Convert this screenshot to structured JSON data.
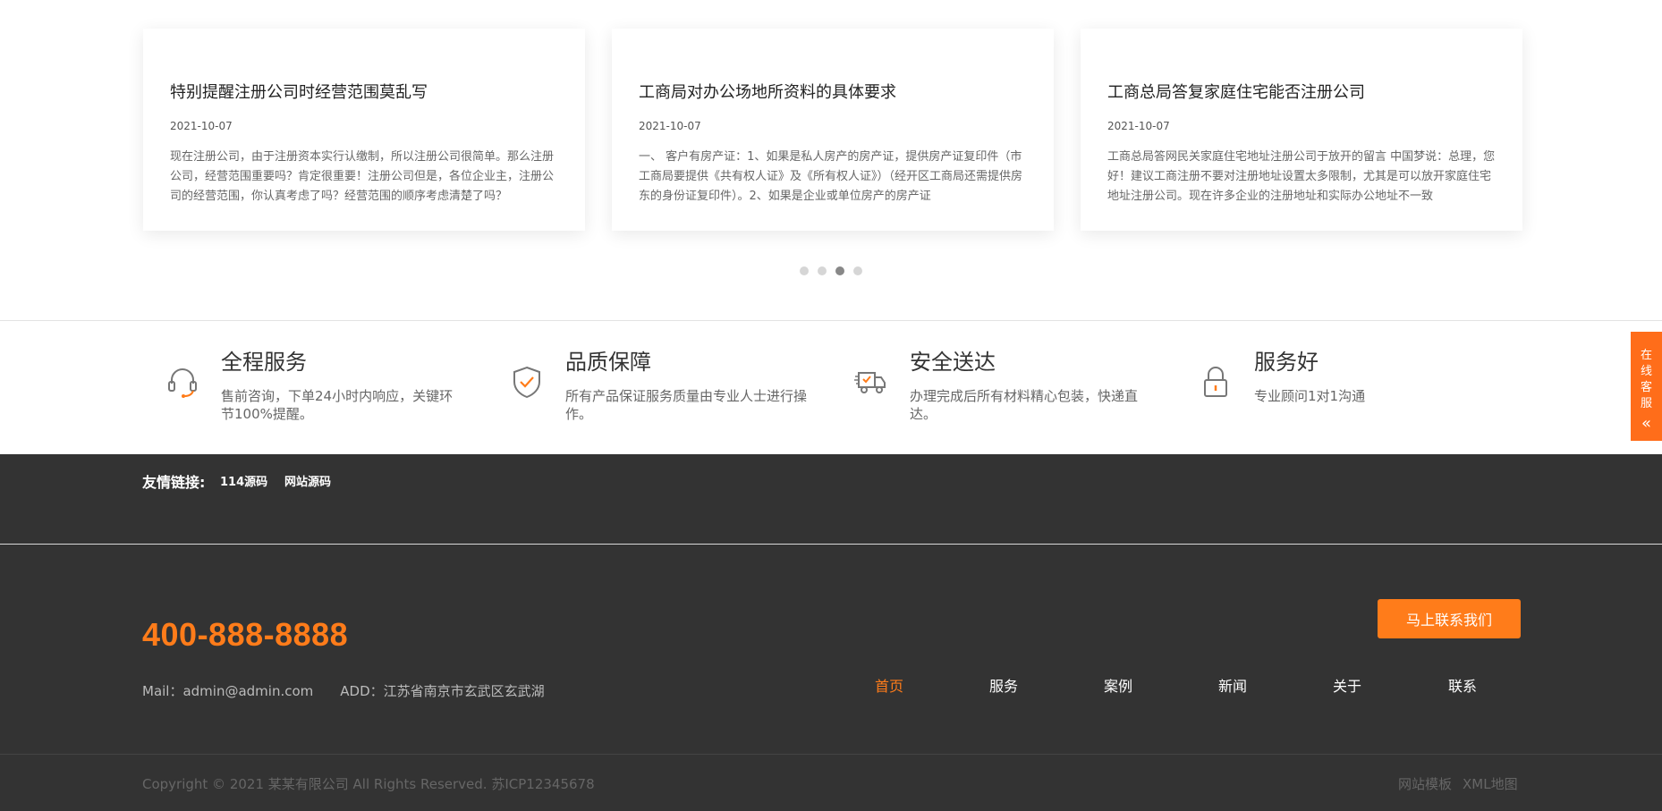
{
  "news": {
    "cards": [
      {
        "title": "特别提醒注册公司时经营范围莫乱写",
        "date": "2021-10-07",
        "excerpt": "现在注册公司，由于注册资本实行认缴制，所以注册公司很简单。那么注册公司，经营范围重要吗？肯定很重要！注册公司但是，各位企业主，注册公司的经营范围，你认真考虑了吗？经营范围的顺序考虑清楚了吗？"
      },
      {
        "title": "工商局对办公场地所资料的具体要求",
        "date": "2021-10-07",
        "excerpt": "一、 客户有房产证：1、如果是私人房产的房产证，提供房产证复印件（市工商局要提供《共有权人证》及《所有权人证》）（经开区工商局还需提供房东的身份证复印件）。2、如果是企业或单位房产的房产证"
      },
      {
        "title": "工商总局答复家庭住宅能否注册公司",
        "date": "2021-10-07",
        "excerpt": "工商总局答网民关家庭住宅地址注册公司于放开的留言 中国梦说：总理，您好！建议工商注册不要对注册地址设置太多限制，尤其是可以放开家庭住宅地址注册公司。现在许多企业的注册地址和实际办公地址不一致"
      }
    ],
    "pagination": {
      "total": 4,
      "active_index": 2
    }
  },
  "features": [
    {
      "icon": "headset-icon",
      "title": "全程服务",
      "desc": "售前咨询，下单24小时内响应，关键环节100%提醒。"
    },
    {
      "icon": "shield-check-icon",
      "title": "品质保障",
      "desc": "所有产品保证服务质量由专业人士进行操作。"
    },
    {
      "icon": "truck-icon",
      "title": "安全送达",
      "desc": "办理完成后所有材料精心包装，快递直达。"
    },
    {
      "icon": "lock-icon",
      "title": "服务好",
      "desc": "专业顾问1对1沟通"
    }
  ],
  "links": {
    "label": "友情链接:",
    "items": [
      "114源码",
      "网站源码"
    ]
  },
  "footer": {
    "phone": "400-888-8888",
    "mail": "Mail：admin@admin.com",
    "address": "ADD：江苏省南京市玄武区玄武湖",
    "cta_label": "马上联系我们",
    "nav": [
      "首页",
      "服务",
      "案例",
      "新闻",
      "关于",
      "联系"
    ],
    "nav_active_index": 0,
    "copyright": "Copyright © 2021 某某有限公司 All Rights Reserved. 苏ICP12345678",
    "bottom_links": [
      "网站模板",
      "XML地图"
    ]
  },
  "float_service": {
    "label": "在线客服",
    "icon": "double-chevron-left-icon"
  },
  "colors": {
    "accent": "#ff7c1a",
    "footer_bg": "#333333"
  }
}
